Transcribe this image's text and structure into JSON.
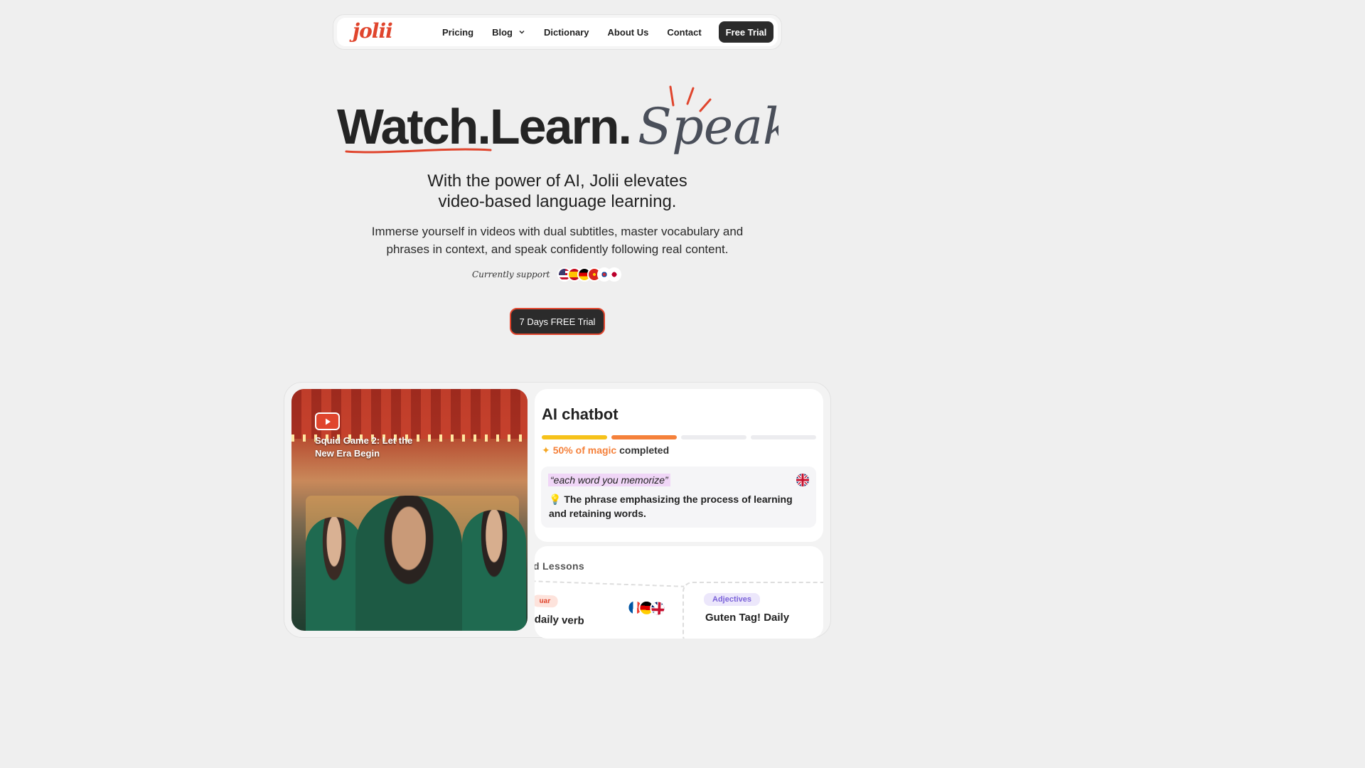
{
  "nav": {
    "logo": "jolii",
    "links": [
      {
        "label": "Pricing"
      },
      {
        "label": "Blog",
        "has_dropdown": true
      },
      {
        "label": "Dictionary"
      },
      {
        "label": "About Us"
      },
      {
        "label": "Contact"
      }
    ],
    "cta_label": "Free Trial"
  },
  "hero": {
    "headline_1": "Watch.",
    "headline_2": "Learn.",
    "headline_3": "Speak",
    "subtitle_line1": "With the power of AI, Jolii elevates",
    "subtitle_line2": "video-based language learning.",
    "description_line1": "Immerse yourself in videos with dual subtitles, master vocabulary and",
    "description_line2": "phrases in context, and speak confidently following real content.",
    "support_label": "Currently support",
    "languages": [
      "us-flag-icon",
      "spain-flag-icon",
      "germany-flag-icon",
      "vietnam-flag-icon",
      "korea-flag-icon",
      "japan-flag-icon"
    ],
    "cta_label": "7 Days FREE Trial"
  },
  "showcase": {
    "video": {
      "title": "Squid Game 2: Let the New Era Begin",
      "icon": "youtube-play-icon"
    },
    "chatbot": {
      "title": "AI chatbot",
      "progress_segments_total": 4,
      "progress_segments_filled": 2,
      "progress_magic": "50% of magic",
      "progress_suffix": "completed",
      "phrase": "“each word you memorize”",
      "explanation": "The phrase emphasizing the process of learning and retaining words."
    },
    "lessons": {
      "title": "d Lessons",
      "card_a_tag": "uar",
      "card_a_text": "daily verb",
      "card_b_tag": "Adjectives",
      "card_b_text": "Guten Tag! Daily"
    }
  },
  "colors": {
    "accent": "#e0452d",
    "dark": "#2b2b2b",
    "progress_yellow": "#f6c21b",
    "progress_orange": "#f5813b"
  }
}
